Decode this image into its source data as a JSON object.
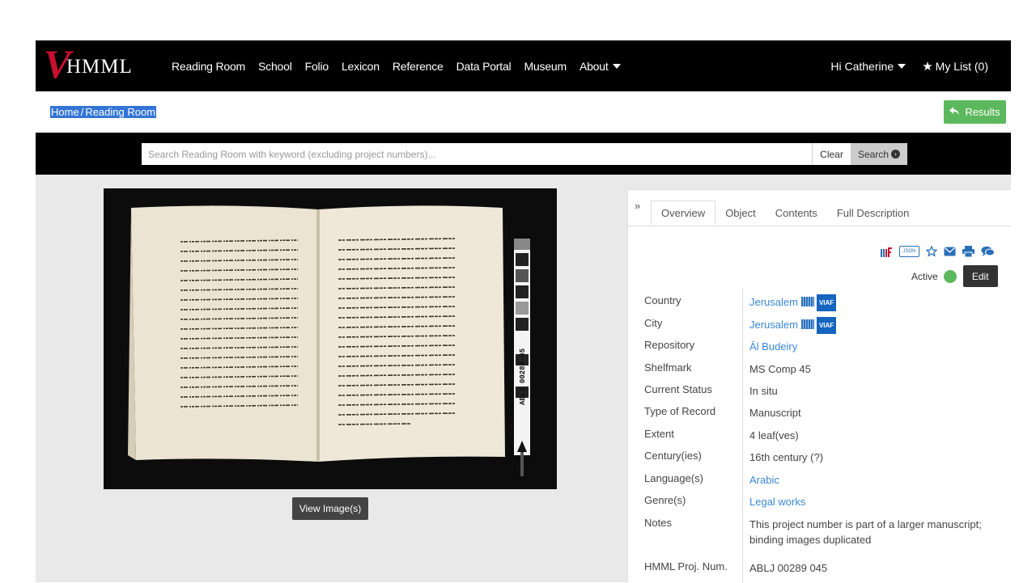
{
  "nav": {
    "logo_v": "V",
    "logo_text": "HMML",
    "links": [
      "Reading Room",
      "School",
      "Folio",
      "Lexicon",
      "Reference",
      "Data Portal",
      "Museum",
      "About"
    ],
    "user": "Hi Catherine",
    "my_list": "My List (0)"
  },
  "breadcrumb": {
    "home": "Home",
    "sep": "/",
    "current": "Reading Room"
  },
  "results_label": "Results",
  "search": {
    "placeholder": "Search Reading Room with keyword (excluding project numbers)...",
    "clear_label": "Clear",
    "search_label": "Search"
  },
  "image": {
    "ruler_label": "ABLJ 00289-45",
    "view_label": "View Image(s)"
  },
  "details": {
    "collapse": "»",
    "tabs": [
      "Overview",
      "Object",
      "Contents",
      "Full Description"
    ],
    "active_tab": "Overview",
    "json_icon_text": "JSON",
    "status_label": "Active",
    "edit_label": "Edit",
    "viaf": "VIAF",
    "fields": [
      {
        "label": "Country",
        "value": "Jerusalem"
      },
      {
        "label": "City",
        "value": "Jerusalem"
      },
      {
        "label": "Repository",
        "value": "Āl Budeiry"
      },
      {
        "label": "Shelfmark",
        "value": "MS Comp 45"
      },
      {
        "label": "Current Status",
        "value": "In situ"
      },
      {
        "label": "Type of Record",
        "value": "Manuscript"
      },
      {
        "label": "Extent",
        "value": "4 leaf(ves)"
      },
      {
        "label": "Century(ies)",
        "value": "16th century (?)"
      },
      {
        "label": "Language(s)",
        "value": "Arabic"
      },
      {
        "label": "Genre(s)",
        "value": "Legal works"
      },
      {
        "label": "Notes",
        "value": "This project number is part of a larger manuscript; binding images duplicated"
      },
      {
        "label": "HMML Proj. Num.",
        "value": "ABLJ 00289 045"
      }
    ]
  },
  "colors": {
    "nav_bg": "#000000",
    "accent_link": "#3a87d6",
    "results_green": "#5cb85c",
    "logo_red": "#c8102e"
  }
}
